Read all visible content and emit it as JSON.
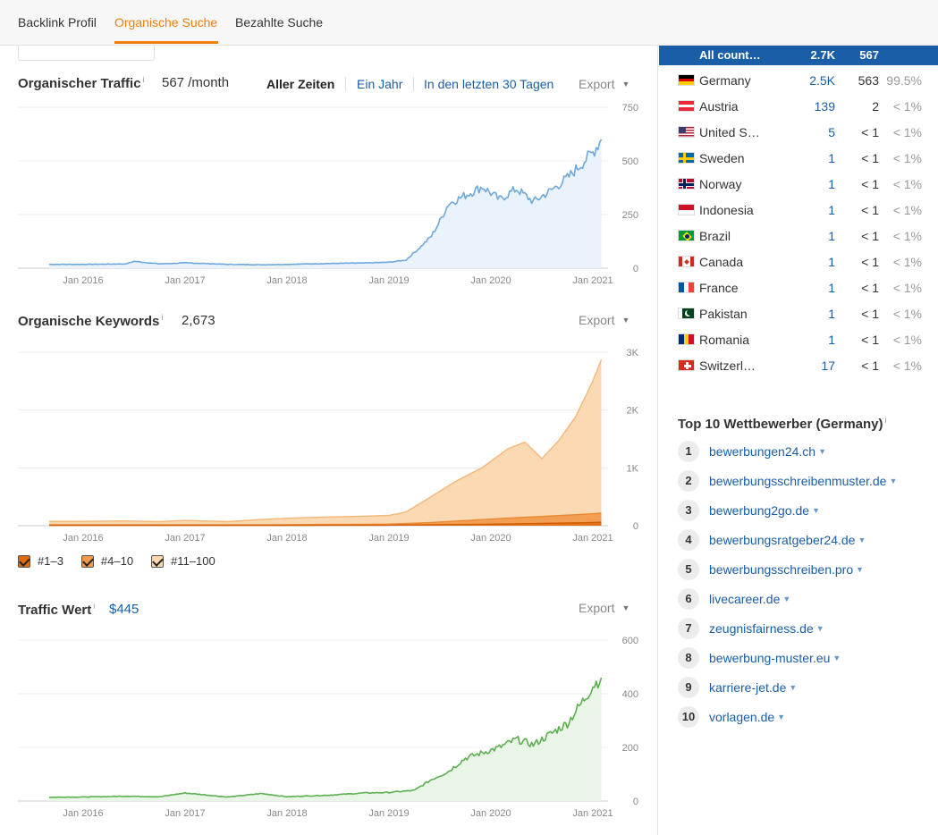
{
  "tabs": [
    {
      "label": "Backlink Profil",
      "active": false
    },
    {
      "label": "Organische Suche",
      "active": true
    },
    {
      "label": "Bezahlte Suche",
      "active": false
    }
  ],
  "traffic": {
    "title": "Organischer Traffic",
    "info": "i",
    "value": "567 /month",
    "ranges": [
      "Aller Zeiten",
      "Ein Jahr",
      "In den letzten 30 Tagen"
    ],
    "export": "Export"
  },
  "keywords": {
    "title": "Organische Keywords",
    "info": "i",
    "value": "2,673",
    "export": "Export",
    "legend": [
      "#1–3",
      "#4–10",
      "#11–100"
    ]
  },
  "value": {
    "title": "Traffic Wert",
    "info": "i",
    "value": "$445",
    "export": "Export"
  },
  "countries": {
    "header": {
      "name": "All count…",
      "traffic": "2.7K",
      "keywords": "567"
    },
    "rows": [
      {
        "flag": "de",
        "name": "Germany",
        "traffic": "2.5K",
        "keywords": "563",
        "pct": "99.5%"
      },
      {
        "flag": "at",
        "name": "Austria",
        "traffic": "139",
        "keywords": "2",
        "pct": "< 1%"
      },
      {
        "flag": "us",
        "name": "United S…",
        "traffic": "5",
        "keywords": "< 1",
        "pct": "< 1%"
      },
      {
        "flag": "se",
        "name": "Sweden",
        "traffic": "1",
        "keywords": "< 1",
        "pct": "< 1%"
      },
      {
        "flag": "no",
        "name": "Norway",
        "traffic": "1",
        "keywords": "< 1",
        "pct": "< 1%"
      },
      {
        "flag": "id",
        "name": "Indonesia",
        "traffic": "1",
        "keywords": "< 1",
        "pct": "< 1%"
      },
      {
        "flag": "br",
        "name": "Brazil",
        "traffic": "1",
        "keywords": "< 1",
        "pct": "< 1%"
      },
      {
        "flag": "ca",
        "name": "Canada",
        "traffic": "1",
        "keywords": "< 1",
        "pct": "< 1%"
      },
      {
        "flag": "fr",
        "name": "France",
        "traffic": "1",
        "keywords": "< 1",
        "pct": "< 1%"
      },
      {
        "flag": "pk",
        "name": "Pakistan",
        "traffic": "1",
        "keywords": "< 1",
        "pct": "< 1%"
      },
      {
        "flag": "ro",
        "name": "Romania",
        "traffic": "1",
        "keywords": "< 1",
        "pct": "< 1%"
      },
      {
        "flag": "ch",
        "name": "Switzerl…",
        "traffic": "17",
        "keywords": "< 1",
        "pct": "< 1%"
      }
    ]
  },
  "competitors": {
    "title": "Top 10 Wettbewerber (Germany)",
    "info": "i",
    "items": [
      {
        "rank": "1",
        "domain": "bewerbungen24.ch"
      },
      {
        "rank": "2",
        "domain": "bewerbungsschreibenmuster.de"
      },
      {
        "rank": "3",
        "domain": "bewerbung2go.de"
      },
      {
        "rank": "4",
        "domain": "bewerbungsratgeber24.de"
      },
      {
        "rank": "5",
        "domain": "bewerbungsschreiben.pro"
      },
      {
        "rank": "6",
        "domain": "livecareer.de"
      },
      {
        "rank": "7",
        "domain": "zeugnisfairness.de"
      },
      {
        "rank": "8",
        "domain": "bewerbung-muster.eu"
      },
      {
        "rank": "9",
        "domain": "karriere-jet.de"
      },
      {
        "rank": "10",
        "domain": "vorlagen.de"
      }
    ]
  },
  "colors": {
    "accent": "#f07d0c",
    "link": "#1a5ea8",
    "traffic_line": "#6fa8dc",
    "traffic_fill": "#eaf2fb",
    "kw_top3": "#e06a0a",
    "kw_top10": "#f29a4a",
    "kw_top100": "#fbd7ae",
    "value_line": "#5cb050",
    "value_fill": "#e9f5e7"
  },
  "chart_data": [
    {
      "type": "area",
      "title": "Organischer Traffic",
      "x_ticks": [
        "Jan 2016",
        "Jan 2017",
        "Jan 2018",
        "Jan 2019",
        "Jan 2020",
        "Jan 2021"
      ],
      "y_ticks": [
        "750",
        "500",
        "250",
        "0"
      ],
      "ylim": [
        0,
        750
      ],
      "x": [
        "2015-09",
        "2016-01",
        "2016-06",
        "2016-07",
        "2016-10",
        "2017-01",
        "2017-06",
        "2017-10",
        "2018-01",
        "2018-06",
        "2018-10",
        "2019-01",
        "2019-03",
        "2019-05",
        "2019-06",
        "2019-07",
        "2019-08",
        "2019-10",
        "2019-12",
        "2020-02",
        "2020-04",
        "2020-06",
        "2020-08",
        "2020-10",
        "2020-12",
        "2021-01",
        "2021-02"
      ],
      "series": [
        {
          "values": [
            18,
            18,
            20,
            32,
            20,
            25,
            18,
            16,
            18,
            22,
            24,
            28,
            38,
            110,
            150,
            220,
            300,
            340,
            380,
            320,
            370,
            310,
            360,
            420,
            500,
            540,
            600
          ]
        }
      ]
    },
    {
      "type": "area",
      "title": "Organische Keywords",
      "x_ticks": [
        "Jan 2016",
        "Jan 2017",
        "Jan 2018",
        "Jan 2019",
        "Jan 2020",
        "Jan 2021"
      ],
      "y_ticks": [
        "3K",
        "2K",
        "1K",
        "0"
      ],
      "ylim": [
        0,
        3000
      ],
      "x": [
        "2015-09",
        "2016-01",
        "2016-06",
        "2016-10",
        "2017-01",
        "2017-06",
        "2017-10",
        "2018-01",
        "2018-06",
        "2018-10",
        "2019-01",
        "2019-03",
        "2019-06",
        "2019-09",
        "2019-12",
        "2020-03",
        "2020-05",
        "2020-07",
        "2020-09",
        "2020-11",
        "2021-01",
        "2021-02"
      ],
      "series": [
        {
          "name": "#1–3",
          "values": [
            5,
            5,
            5,
            5,
            5,
            5,
            5,
            5,
            6,
            8,
            10,
            12,
            15,
            20,
            25,
            30,
            35,
            40,
            45,
            50,
            55,
            60
          ]
        },
        {
          "name": "#4–10",
          "values": [
            10,
            10,
            12,
            10,
            12,
            10,
            12,
            14,
            15,
            16,
            18,
            25,
            40,
            60,
            80,
            100,
            110,
            120,
            130,
            140,
            150,
            160
          ]
        },
        {
          "name": "#11–100",
          "values": [
            60,
            60,
            65,
            55,
            75,
            55,
            90,
            110,
            130,
            140,
            150,
            200,
            450,
            700,
            900,
            1200,
            1300,
            1000,
            1300,
            1700,
            2300,
            2650
          ]
        }
      ]
    },
    {
      "type": "area",
      "title": "Traffic Wert",
      "x_ticks": [
        "Jan 2016",
        "Jan 2017",
        "Jan 2018",
        "Jan 2019",
        "Jan 2020",
        "Jan 2021"
      ],
      "y_ticks": [
        "600",
        "400",
        "200",
        "0"
      ],
      "ylim": [
        0,
        600
      ],
      "x": [
        "2015-09",
        "2016-01",
        "2016-06",
        "2016-10",
        "2017-01",
        "2017-06",
        "2017-10",
        "2018-01",
        "2018-06",
        "2018-10",
        "2019-01",
        "2019-04",
        "2019-06",
        "2019-08",
        "2019-10",
        "2019-12",
        "2020-02",
        "2020-04",
        "2020-06",
        "2020-08",
        "2020-10",
        "2020-12",
        "2021-01",
        "2021-02"
      ],
      "series": [
        {
          "values": [
            14,
            15,
            18,
            16,
            30,
            15,
            28,
            16,
            22,
            30,
            32,
            40,
            80,
            110,
            160,
            180,
            200,
            230,
            210,
            250,
            290,
            380,
            430,
            460
          ]
        }
      ]
    }
  ]
}
